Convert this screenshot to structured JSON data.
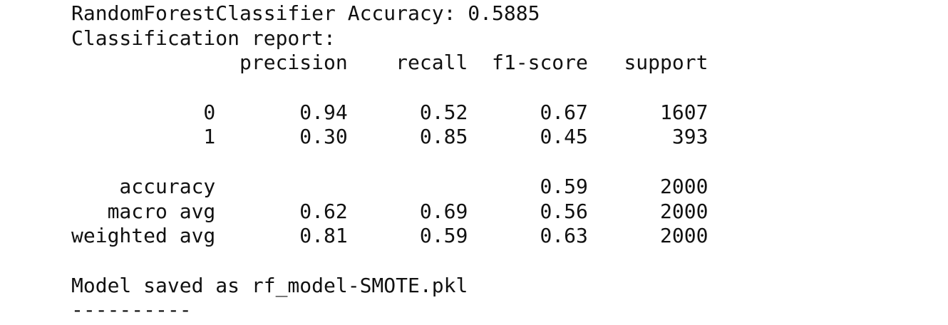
{
  "output": {
    "lines": [
      "RandomForestClassifier Accuracy: 0.5885",
      "Classification report:",
      "              precision    recall  f1-score   support",
      "",
      "           0       0.94      0.52      0.67      1607",
      "           1       0.30      0.85      0.45       393",
      "",
      "    accuracy                           0.59      2000",
      "   macro avg       0.62      0.69      0.56      2000",
      "weighted avg       0.81      0.59      0.63      2000",
      "",
      "Model saved as rf_model-SMOTE.pkl",
      "----------"
    ]
  }
}
